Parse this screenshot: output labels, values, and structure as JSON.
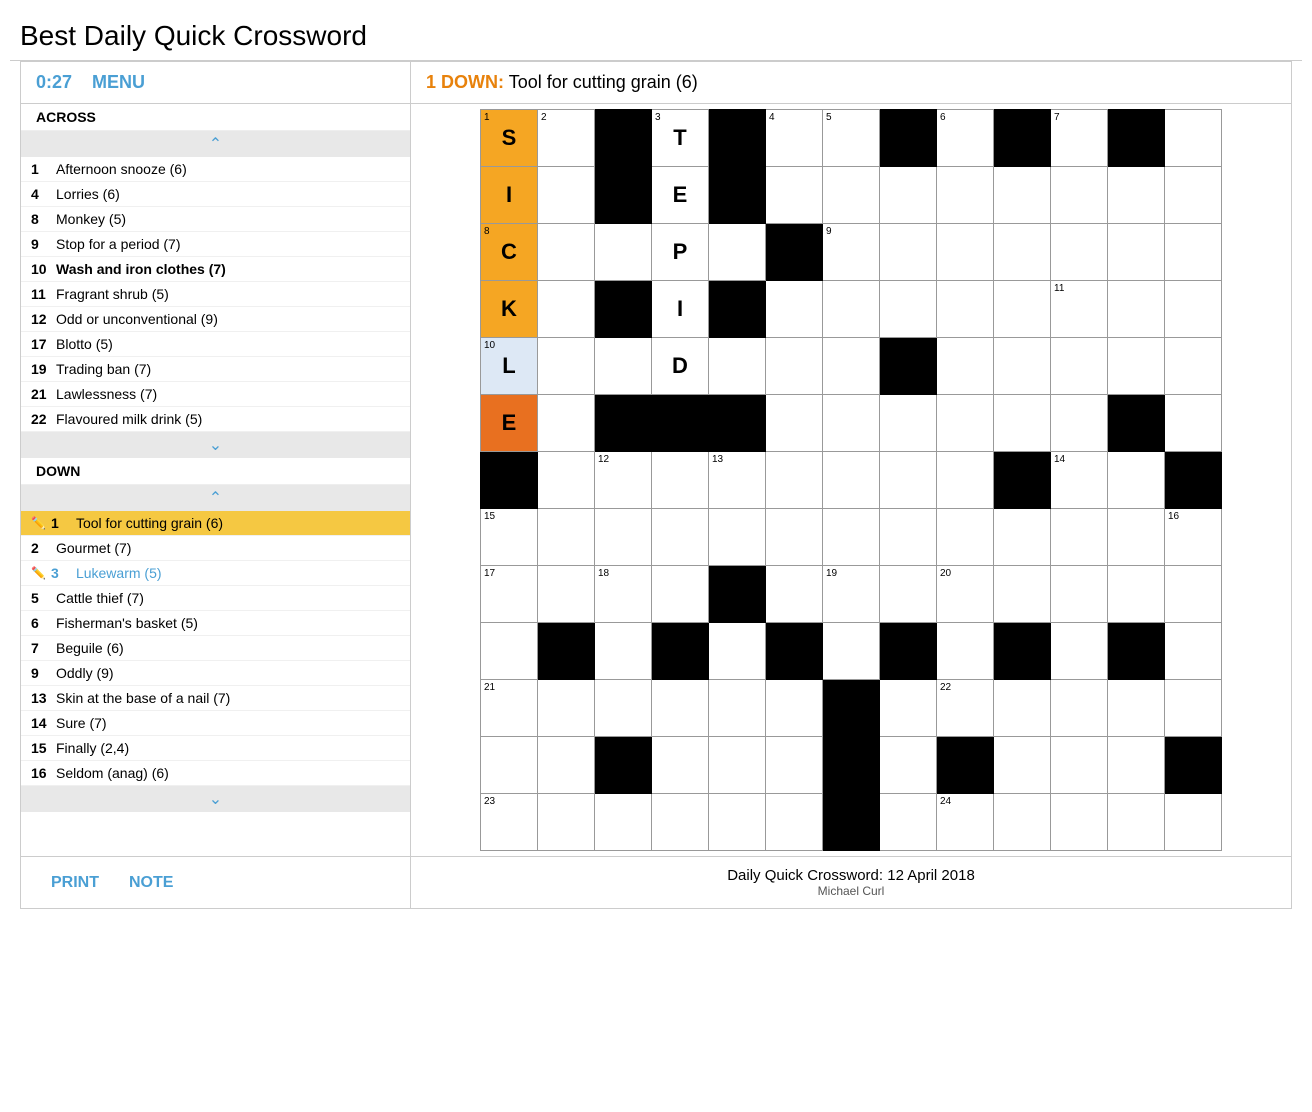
{
  "page": {
    "title": "Best Daily Quick Crossword"
  },
  "header": {
    "timer": "0:27",
    "menu_label": "MENU",
    "active_clue_number": "1 DOWN:",
    "active_clue_text": " Tool for cutting grain (6)"
  },
  "across_header": "ACROSS",
  "down_header": "DOWN",
  "across_clues": [
    {
      "number": "1",
      "text": "Afternoon snooze (6)",
      "completed": false,
      "active": false
    },
    {
      "number": "4",
      "text": "Lorries (6)",
      "completed": false,
      "active": false
    },
    {
      "number": "8",
      "text": "Monkey (5)",
      "completed": false,
      "active": false
    },
    {
      "number": "9",
      "text": "Stop for a period (7)",
      "completed": false,
      "active": false
    },
    {
      "number": "10",
      "text": "Wash and iron clothes (7)",
      "completed": false,
      "active": false,
      "bold": true
    },
    {
      "number": "11",
      "text": "Fragrant shrub (5)",
      "completed": false,
      "active": false
    },
    {
      "number": "12",
      "text": "Odd or unconventional (9)",
      "completed": false,
      "active": false
    },
    {
      "number": "17",
      "text": "Blotto (5)",
      "completed": false,
      "active": false
    },
    {
      "number": "19",
      "text": "Trading ban (7)",
      "completed": false,
      "active": false
    },
    {
      "number": "21",
      "text": "Lawlessness (7)",
      "completed": false,
      "active": false
    },
    {
      "number": "22",
      "text": "Flavoured milk drink (5)",
      "completed": false,
      "active": false
    }
  ],
  "down_clues": [
    {
      "number": "1",
      "text": "Tool for cutting grain (6)",
      "completed": false,
      "active": true,
      "icon": "pencil"
    },
    {
      "number": "2",
      "text": "Gourmet (7)",
      "completed": false,
      "active": false
    },
    {
      "number": "3",
      "text": "Lukewarm (5)",
      "completed": true,
      "active": false,
      "icon": "pencil"
    },
    {
      "number": "5",
      "text": "Cattle thief (7)",
      "completed": false,
      "active": false
    },
    {
      "number": "6",
      "text": "Fisherman's basket (5)",
      "completed": false,
      "active": false
    },
    {
      "number": "7",
      "text": "Beguile (6)",
      "completed": false,
      "active": false
    },
    {
      "number": "9",
      "text": "Oddly (9)",
      "completed": false,
      "active": false
    },
    {
      "number": "13",
      "text": "Skin at the base of a nail (7)",
      "completed": false,
      "active": false
    },
    {
      "number": "14",
      "text": "Sure (7)",
      "completed": false,
      "active": false
    },
    {
      "number": "15",
      "text": "Finally (2,4)",
      "completed": false,
      "active": false
    },
    {
      "number": "16",
      "text": "Seldom (anag) (6)",
      "completed": false,
      "active": false
    }
  ],
  "footer": {
    "print_label": "PRINT",
    "note_label": "NOTE",
    "attribution": "Daily Quick Crossword: 12 April 2018",
    "author": "Michael Curl"
  },
  "grid": {
    "rows": 13,
    "cols": 13
  }
}
